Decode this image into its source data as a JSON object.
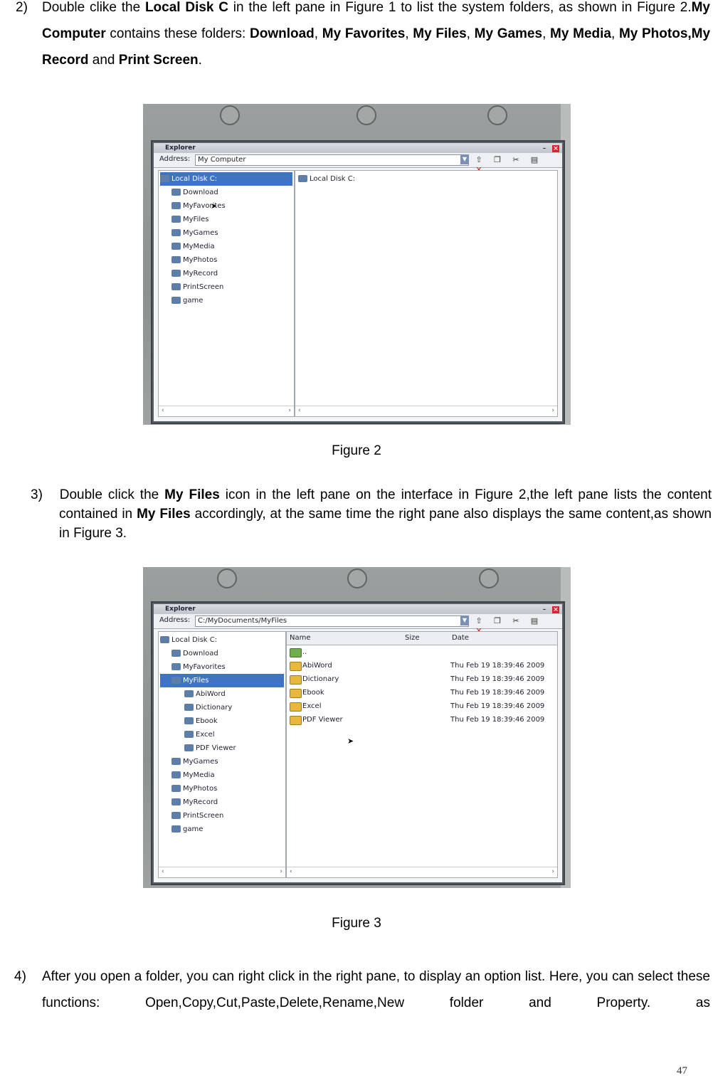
{
  "step2": {
    "num": "2)",
    "t1": "Double clike the ",
    "b1": "Local Disk C",
    "t2": " in the left pane in Figure 1 to list the system folders, as shown in Figure 2.",
    "b2": "My Computer",
    "t3": " contains these folders: ",
    "b3": "Download",
    "s1": ", ",
    "b4": "My Favorites",
    "s2": ", ",
    "b5": "My Files",
    "s3": ", ",
    "b6": "My Games",
    "s4": ", ",
    "b7": "My Media",
    "s5": ", ",
    "b8": "My Photos,My Record",
    "t4": " and ",
    "b9": "Print Screen",
    "t5": "."
  },
  "figure2": {
    "caption": "Figure 2",
    "window_title": "Explorer",
    "address_label": "Address:",
    "address_value": "My Computer",
    "left_tree": {
      "root": "Local Disk C:",
      "items": [
        "Download",
        "MyFavorites",
        "MyFiles",
        "MyGames",
        "MyMedia",
        "MyPhotos",
        "MyRecord",
        "PrintScreen",
        "game"
      ]
    },
    "right_root": "Local Disk C:"
  },
  "step3": {
    "num": "3)",
    "t1": "Double click the ",
    "b1": "My Files",
    "t2": " icon in the left pane on the interface in Figure 2,the left pane lists the content contained in ",
    "b2": "My Files",
    "t3": " accordingly, at the same time the right pane also displays the same content,as shown in Figure 3."
  },
  "figure3": {
    "caption": "Figure 3",
    "window_title": "Explorer",
    "address_label": "Address:",
    "address_value": "C:/MyDocuments/MyFiles",
    "left_tree": {
      "root": "Local Disk C:",
      "top": [
        "Download",
        "MyFavorites"
      ],
      "selected": "MyFiles",
      "children": [
        "AbiWord",
        "Dictionary",
        "Ebook",
        "Excel",
        "PDF Viewer"
      ],
      "bottom": [
        "MyGames",
        "MyMedia",
        "MyPhotos",
        "MyRecord",
        "PrintScreen",
        "game"
      ]
    },
    "columns": {
      "name": "Name",
      "size": "Size",
      "date": "Date"
    },
    "up_row": "..",
    "files": [
      {
        "name": "AbiWord",
        "date": "Thu Feb 19 18:39:46 2009"
      },
      {
        "name": "Dictionary",
        "date": "Thu Feb 19 18:39:46 2009"
      },
      {
        "name": "Ebook",
        "date": "Thu Feb 19 18:39:46 2009"
      },
      {
        "name": "Excel",
        "date": "Thu Feb 19 18:39:46 2009"
      },
      {
        "name": "PDF Viewer",
        "date": "Thu Feb 19 18:39:46 2009"
      }
    ]
  },
  "step4": {
    "num": "4)",
    "text": "After you open a folder, you can right click in the right pane, to display an option list. Here, you can select these functions: Open,Copy,Cut,Paste,Delete,Rename,New folder and Property. as"
  },
  "page_number": "47"
}
